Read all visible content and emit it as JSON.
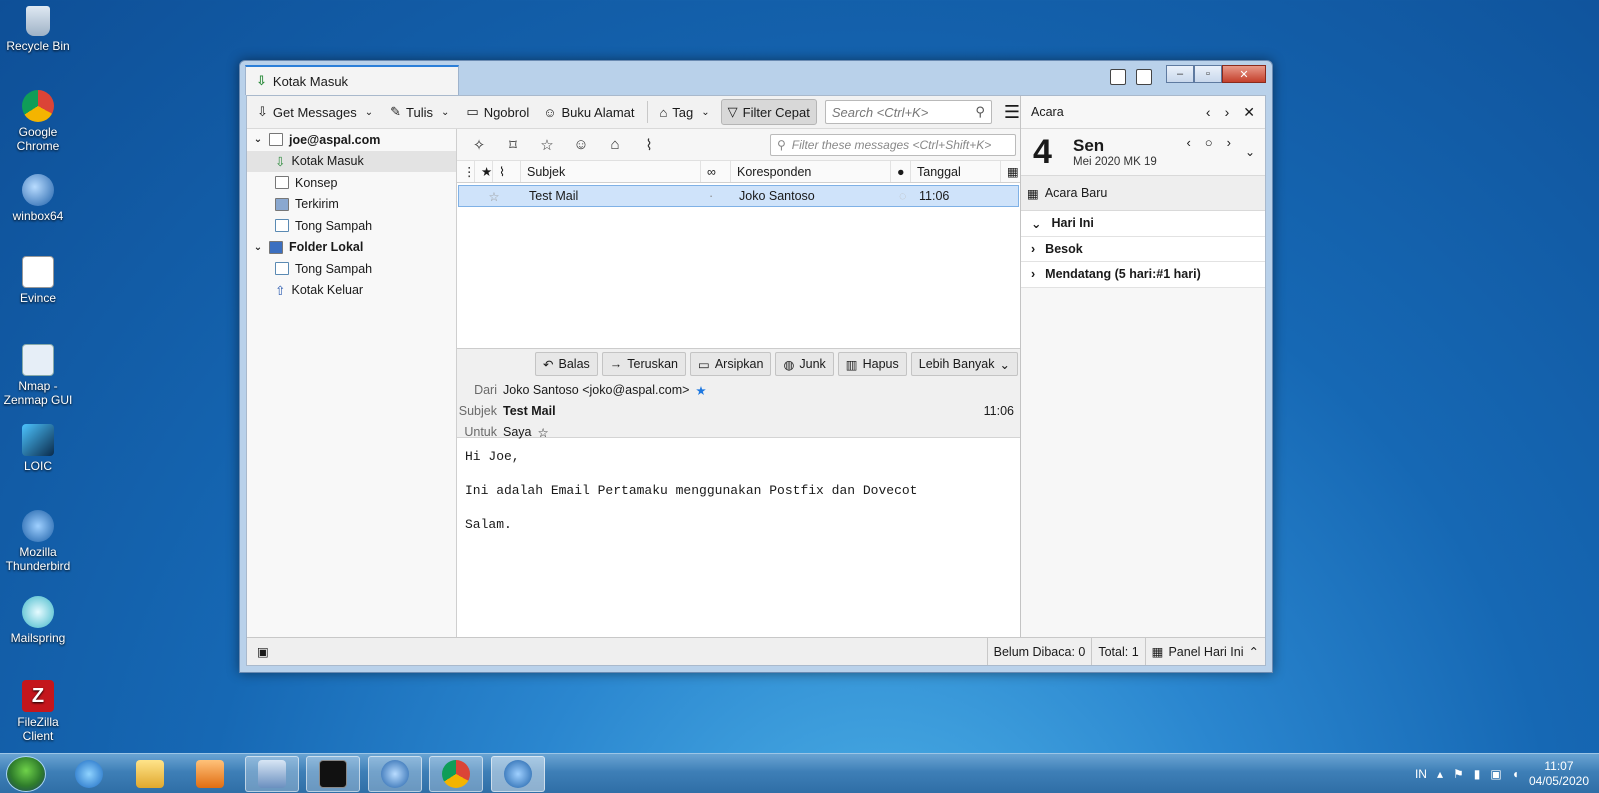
{
  "desktop": {
    "icons": [
      {
        "label": "Recycle Bin"
      },
      {
        "label": "Google Chrome"
      },
      {
        "label": "winbox64"
      },
      {
        "label": "Evince"
      },
      {
        "label": "Nmap - Zenmap GUI"
      },
      {
        "label": "LOIC"
      },
      {
        "label": "Mozilla Thunderbird"
      },
      {
        "label": "Mailspring"
      },
      {
        "label": "FileZilla Client"
      }
    ]
  },
  "window": {
    "tab_title": "Kotak Masuk",
    "controls": {
      "minimize": "–",
      "maximize": "▫",
      "close": "✕"
    }
  },
  "toolbar": {
    "get_messages": "Get Messages",
    "write": "Tulis",
    "chat": "Ngobrol",
    "address_book": "Buku Alamat",
    "tag": "Tag",
    "quick_filter": "Filter Cepat",
    "search_placeholder": "Search <Ctrl+K>"
  },
  "folders": {
    "account": "joe@aspal.com",
    "account_folders": [
      "Kotak Masuk",
      "Konsep",
      "Terkirim",
      "Tong Sampah"
    ],
    "local": "Folder Lokal",
    "local_folders": [
      "Tong Sampah",
      "Kotak Keluar"
    ]
  },
  "message_list": {
    "filter_placeholder": "Filter these messages <Ctrl+Shift+K>",
    "columns": {
      "subject": "Subjek",
      "correspondent": "Koresponden",
      "date": "Tanggal"
    },
    "rows": [
      {
        "subject": "Test Mail",
        "correspondent": "Joko Santoso",
        "date": "11:06"
      }
    ]
  },
  "message_header": {
    "actions": [
      "Balas",
      "Teruskan",
      "Arsipkan",
      "Junk",
      "Hapus",
      "Lebih Banyak"
    ],
    "from_label": "Dari",
    "from_value": "Joko Santoso <joko@aspal.com>",
    "subject_label": "Subjek",
    "subject_value": "Test Mail",
    "time": "11:06",
    "to_label": "Untuk",
    "to_value": "Saya"
  },
  "message_body": {
    "lines": [
      "Hi Joe,",
      "Ini adalah Email Pertamaku menggunakan Postfix dan Dovecot",
      "Salam."
    ]
  },
  "today_pane": {
    "title": "Acara",
    "day_number": "4",
    "day_name": "Sen",
    "month_week": "Mei 2020  MK 19",
    "new_event": "Acara Baru",
    "sections": [
      "Hari Ini",
      "Besok",
      "Mendatang (5 hari:#1 hari)"
    ]
  },
  "statusbar": {
    "unread": "Belum Dibaca: 0",
    "total": "Total: 1",
    "today_panel": "Panel Hari Ini"
  },
  "taskbar": {
    "language": "IN",
    "time": "11:07",
    "date": "04/05/2020"
  },
  "colors": {
    "accent": "#2c7fd8",
    "selection": "#cfe3fa",
    "taskbar": "#3e7fb7"
  }
}
